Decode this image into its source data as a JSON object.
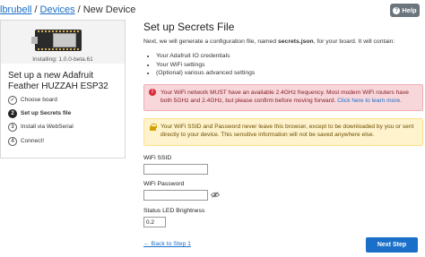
{
  "breadcrumb": {
    "items": [
      {
        "label": "lbrubell",
        "link": true
      },
      {
        "label": "Devices",
        "link": true
      },
      {
        "label": "New Device",
        "link": false
      }
    ],
    "separator": "/"
  },
  "help_button": {
    "label": "Help",
    "icon": "question-circle-icon"
  },
  "sidebar": {
    "installing_text": "Installing: 1.0.0-beta.61",
    "board_title": "Set up a new Adafruit Feather HUZZAH ESP32",
    "steps": [
      {
        "number": "✓",
        "label": "Choose board",
        "state": "done"
      },
      {
        "number": "2",
        "label": "Set up Secrets file",
        "state": "active"
      },
      {
        "number": "3",
        "label": "Install via WebSerial",
        "state": "pending"
      },
      {
        "number": "4",
        "label": "Connect!",
        "state": "pending"
      }
    ]
  },
  "main": {
    "title": "Set up Secrets File",
    "intro_before": "Next, we will generate a configuration file, named ",
    "intro_file": "secrets.json",
    "intro_after": ", for your board. It will contain:",
    "bullets": [
      "Your Adafruit IO credentials",
      "Your WiFi settings",
      "(Optional) various advanced settings"
    ],
    "danger_alert": {
      "text": "Your WiFi network MUST have an available 2.4GHz frequency. Most modern WiFi routers have both 5GHz and 2.4GHz, but please confirm before moving forward.",
      "link": "Click here to learn more."
    },
    "warning_alert": {
      "text": "Your WiFi SSID and Password never leave this browser, except to be downloaded by you or sent directly to your device. This sensitive information will not be saved anywhere else."
    },
    "fields": {
      "ssid_label": "WiFi SSID",
      "ssid_value": "",
      "password_label": "WiFi Password",
      "password_value": "",
      "brightness_label": "Status LED Brightness",
      "brightness_value": "0.2"
    },
    "back_link": "← Back to Step 1",
    "next_button": "Next Step"
  },
  "colors": {
    "link": "#1a6fc9",
    "primary_button": "#1a6fc9",
    "danger_bg": "#f8d7da",
    "warning_bg": "#fff3cd",
    "help_button": "#6c757d"
  }
}
